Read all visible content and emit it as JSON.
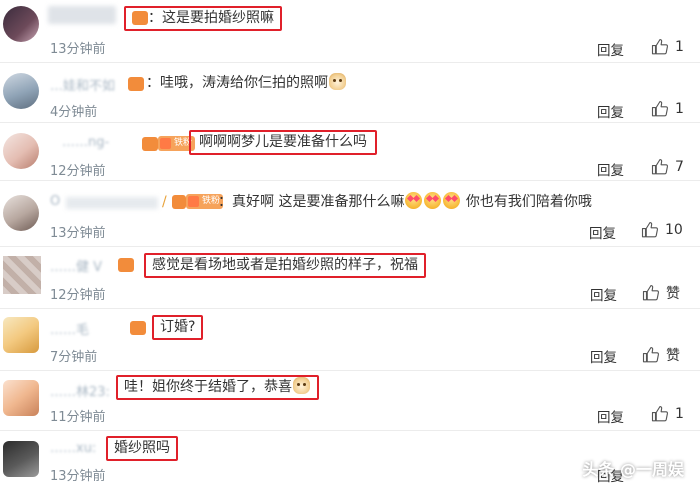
{
  "comments": [
    {
      "name": "",
      "text": "：这是要拍婚纱照嘛",
      "time": "13分钟前",
      "reply_label": "回复",
      "like_label": "",
      "like_count": "1",
      "highlighted": true
    },
    {
      "name": "…娃和不如",
      "text": "：哇哦，涛涛给你仨拍的照啊",
      "time": "4分钟前",
      "reply_label": "回复",
      "like_count": "1",
      "highlighted": false
    },
    {
      "name": "……ng-",
      "fan_level": "铁粉",
      "text": "啊啊啊梦儿是要准备什么吗",
      "time": "12分钟前",
      "reply_label": "回复",
      "like_count": "7",
      "highlighted": true
    },
    {
      "name": "O",
      "fan_level": "铁粉",
      "text_before": "：真好啊 这是要准备那什么嘛",
      "text_after": "你也有我们陪着你哦",
      "time": "13分钟前",
      "reply_label": "回复",
      "like_count": "10",
      "highlighted": false
    },
    {
      "name": "……健 V",
      "text": "感觉是看场地或者是拍婚纱照的样子，祝福",
      "time": "12分钟前",
      "reply_label": "回复",
      "like_label": "赞",
      "highlighted": true
    },
    {
      "name": "……毛",
      "text": "订婚?",
      "time": "7分钟前",
      "reply_label": "回复",
      "like_label": "赞",
      "highlighted": true
    },
    {
      "name": "……林23:",
      "text": "哇！姐你终于结婚了，恭喜",
      "time": "11分钟前",
      "reply_label": "回复",
      "like_count": "1",
      "highlighted": true
    },
    {
      "name": "……xu:",
      "text": "婚纱照吗",
      "time": "13分钟前",
      "reply_label": "回复",
      "highlighted": true
    }
  ],
  "watermark": "头条 @一周娱",
  "colors": {
    "highlight_box": "#e0202a",
    "time_text": "#7f8b95",
    "name_text": "#a9b7c4",
    "fan_badge": "#f6a35b"
  }
}
